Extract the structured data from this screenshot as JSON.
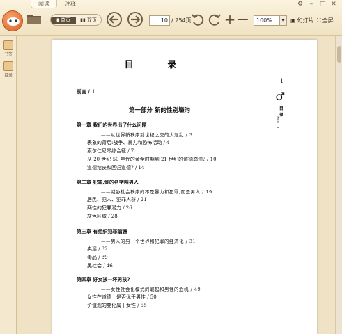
{
  "toolbar": {
    "tabs": [
      "阅读",
      "注释"
    ],
    "view_single": "单页",
    "view_double": "双页",
    "current_page": "10",
    "total_pages": "/ 254页",
    "zoom": "100%",
    "slideshow": "幻灯片",
    "fullscreen": "全屏",
    "window_controls": [
      "设置",
      "最小化",
      "最大化",
      "关闭"
    ]
  },
  "sidebar": {
    "items": [
      {
        "label": "书签",
        "icon": "bookmark-icon"
      },
      {
        "label": "目录",
        "icon": "toc-icon"
      }
    ]
  },
  "document": {
    "title": "目 录",
    "margin": {
      "page_num": "1",
      "symbol": "♂",
      "mu": "目",
      "lu": "录",
      "vertical": "MULU"
    },
    "entries": [
      {
        "text": "前言 / 1",
        "style": "bold"
      },
      {
        "text": "第一部分   新的性别壕沟",
        "style": "part"
      },
      {
        "text": "第一章   我们的世界出了什么问题",
        "style": "bold"
      },
      {
        "text": "——从世界新秩序到世纪之交的大混乱 / 3",
        "style": "sub"
      },
      {
        "text": "表象的背后:战争、暴力和恐怖活动 / 4",
        "style": "normal"
      },
      {
        "text": "索尔仁尼琴综合征 / 7",
        "style": "normal"
      },
      {
        "text": "从 20 世纪 50 年代的黄金时期到 21 世纪的道德崩溃? / 10",
        "style": "normal"
      },
      {
        "text": "道德沦丧和回归道德? / 14",
        "style": "normal"
      },
      {
        "text": "第二章   犯罪,你的名字叫男人",
        "style": "bold"
      },
      {
        "text": "——威胁社会秩序的不是暴力和犯罪,而是男人 / 19",
        "style": "sub"
      },
      {
        "text": "居民、犯人、犯罪人群 / 21",
        "style": "normal"
      },
      {
        "text": "两性的犯罪潜力 / 26",
        "style": "normal"
      },
      {
        "text": "灰色区域 / 28",
        "style": "normal"
      },
      {
        "text": "第三章   有组织犯罪猖獗",
        "style": "bold"
      },
      {
        "text": "——男人的另一个世界和犯罪的经济化 / 31",
        "style": "sub"
      },
      {
        "text": "卖淫 / 32",
        "style": "normal"
      },
      {
        "text": "毒品 / 39",
        "style": "normal"
      },
      {
        "text": "黑社会 / 46",
        "style": "normal"
      },
      {
        "text": "第四章   好女孩—坏男孩?",
        "style": "bold"
      },
      {
        "text": "——女性社会化模式的崛起和男性的危机 / 49",
        "style": "sub"
      },
      {
        "text": "女性在道德上是否优于男性 / 50",
        "style": "normal"
      },
      {
        "text": "价值观的变化属于女性 / 55",
        "style": "normal"
      }
    ]
  }
}
